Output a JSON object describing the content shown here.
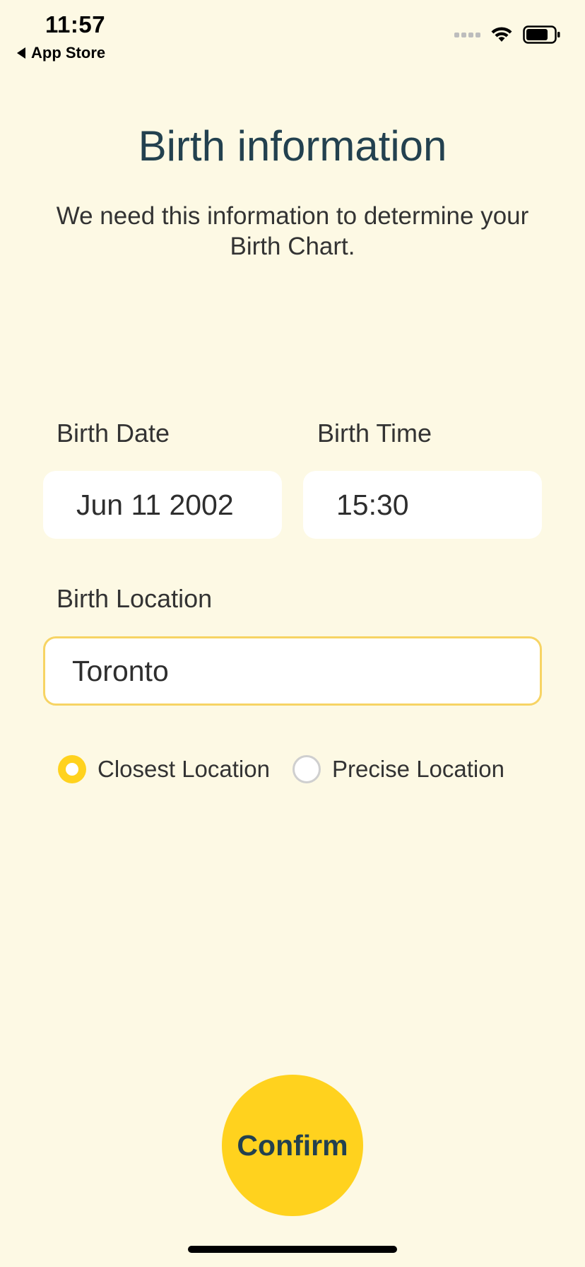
{
  "status_bar": {
    "time": "11:57",
    "back_label": "App Store"
  },
  "header": {
    "title": "Birth information",
    "subtitle": "We need this information to determine your Birth Chart."
  },
  "form": {
    "birth_date": {
      "label": "Birth Date",
      "value": "Jun 11 2002"
    },
    "birth_time": {
      "label": "Birth Time",
      "value": "15:30"
    },
    "birth_location": {
      "label": "Birth Location",
      "value": "Toronto"
    },
    "location_mode": {
      "options": [
        {
          "label": "Closest Location",
          "selected": true
        },
        {
          "label": "Precise Location",
          "selected": false
        }
      ]
    }
  },
  "actions": {
    "confirm_label": "Confirm"
  },
  "colors": {
    "background": "#FDF9E4",
    "accent": "#FFD21E",
    "title": "#23414F",
    "focus_border": "#F7D464"
  }
}
